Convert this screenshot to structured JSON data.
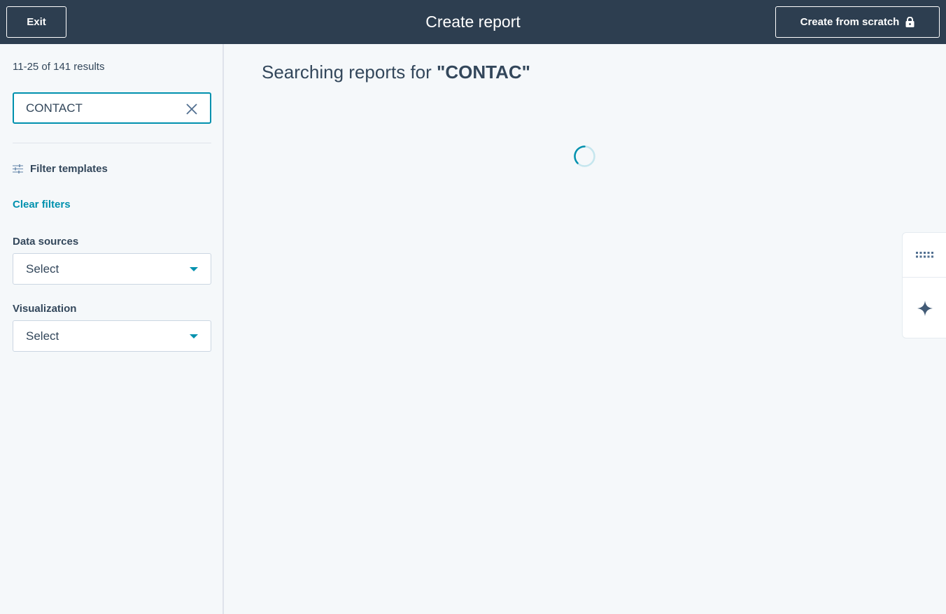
{
  "header": {
    "exit_label": "Exit",
    "title": "Create report",
    "create_scratch_label": "Create from scratch"
  },
  "sidebar": {
    "results_count": "11-25 of 141 results",
    "search": {
      "value": "CONTACT",
      "placeholder": ""
    },
    "filter_label": "Filter templates",
    "clear_filters_label": "Clear filters",
    "data_sources": {
      "label": "Data sources",
      "selected": "Select"
    },
    "visualization": {
      "label": "Visualization",
      "selected": "Select"
    }
  },
  "main": {
    "heading_prefix": "Searching reports for ",
    "heading_query": "\"CONTAC\""
  },
  "icons": {
    "lock": "lock-icon",
    "clear": "close-icon",
    "filter": "sliders-icon",
    "caret": "caret-down-icon",
    "spinner": "loading-spinner-icon",
    "grid": "apps-grid-icon",
    "sparkle": "sparkle-icon"
  },
  "colors": {
    "header_bg": "#2d3e50",
    "accent": "#0091ae",
    "text": "#33475b",
    "page_bg": "#f5f8fa"
  }
}
